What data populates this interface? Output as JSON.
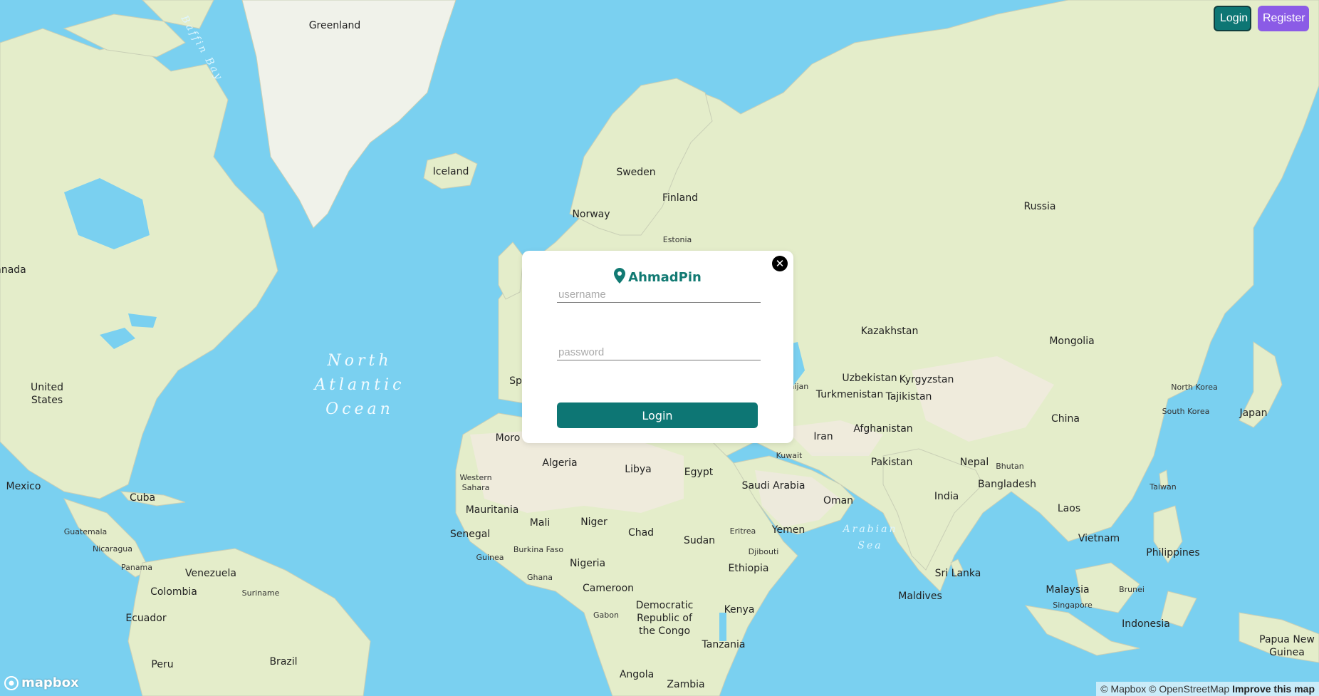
{
  "header": {
    "login_label": "Login",
    "register_label": "Register"
  },
  "modal": {
    "brand": "AhmadPin",
    "username_placeholder": "username",
    "password_placeholder": "password",
    "submit_label": "Login",
    "close_symbol": "✕"
  },
  "map": {
    "labels": {
      "greenland": "Greenland",
      "iceland": "Iceland",
      "sweden": "Sweden",
      "finland": "Finland",
      "norway": "Norway",
      "estonia": "Estonia",
      "russia": "Russia",
      "canada": "anada",
      "united_states": [
        "United",
        "States"
      ],
      "mexico": "Mexico",
      "cuba": "Cuba",
      "guatemala": "Guatemala",
      "nicaragua": "Nicaragua",
      "panama": "Panama",
      "venezuela": "Venezuela",
      "colombia": "Colombia",
      "suriname": "Suriname",
      "ecuador": "Ecuador",
      "peru": "Peru",
      "brazil": "Brazil",
      "kazakhstan": "Kazakhstan",
      "mongolia": "Mongolia",
      "uzbekistan": "Uzbekistan",
      "kyrgyzstan": "Kyrgyzstan",
      "turkmenistan": "Turkmenistan",
      "tajikistan": "Tajikistan",
      "afghanistan": "Afghanistan",
      "iran": "Iran",
      "pakistan": "Pakistan",
      "nepal": "Nepal",
      "bhutan": "Bhutan",
      "bangladesh": "Bangladesh",
      "india": "India",
      "china": "China",
      "north_korea": "North Korea",
      "south_korea": "South Korea",
      "japan": "Japan",
      "taiwan": "Taiwan",
      "laos": "Laos",
      "vietnam": "Vietnam",
      "philippines": "Philippines",
      "malaysia": "Malaysia",
      "brunei": "Brunei",
      "singapore": "Singapore",
      "indonesia": "Indonesia",
      "papua_new_guinea": [
        "Papua New",
        "Guinea"
      ],
      "sri_lanka": "Sri Lanka",
      "maldives": "Maldives",
      "kuwait": "Kuwait",
      "saudi_arabia": "Saudi Arabia",
      "oman": "Oman",
      "yemen": "Yemen",
      "azerbaijan": "aijan",
      "algeria": "Algeria",
      "libya": "Libya",
      "egypt": "Egypt",
      "western_sahara": [
        "Western",
        "Sahara"
      ],
      "mauritania": "Mauritania",
      "mali": "Mali",
      "niger": "Niger",
      "chad": "Chad",
      "sudan": "Sudan",
      "eritrea": "Eritrea",
      "djibouti": "Djibouti",
      "ethiopia": "Ethiopia",
      "senegal": "Senegal",
      "guinea": "Guinea",
      "burkina_faso": "Burkina Faso",
      "ghana": "Ghana",
      "nigeria": "Nigeria",
      "cameroon": "Cameroon",
      "gabon": "Gabon",
      "drc": [
        "Democratic",
        "Republic of",
        "the Congo"
      ],
      "kenya": "Kenya",
      "tanzania": "Tanzania",
      "angola": "Angola",
      "zambia": "Zambia",
      "morocco": "Moro",
      "spain": "Sp"
    },
    "oceans": {
      "north_atlantic": [
        "North",
        "Atlantic",
        "Ocean"
      ],
      "arabian_sea": [
        "Arabian",
        "Sea"
      ],
      "baffin_bay": "Baffin Bay"
    }
  },
  "footer": {
    "logo_text": "mapbox",
    "attribution": "© Mapbox © OpenStreetMap",
    "improve_link": "Improve this map"
  },
  "colors": {
    "primary": "#0d7674",
    "register": "#8b5be6",
    "ocean": "#7ad0f0",
    "land": "#e6efcc"
  }
}
